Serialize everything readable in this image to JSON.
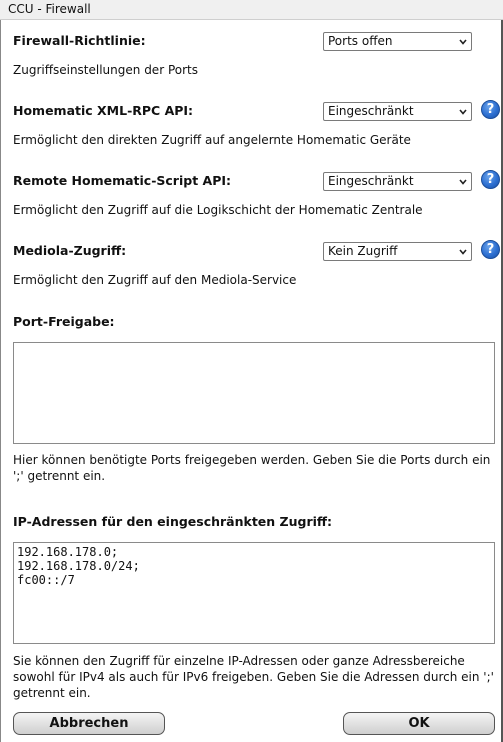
{
  "window": {
    "title": "CCU - Firewall"
  },
  "firewall_policy": {
    "label": "Firewall-Richtlinie:",
    "value": "Ports offen",
    "description": "Zugriffseinstellungen der Ports"
  },
  "xmlrpc_api": {
    "label": "Homematic XML-RPC API:",
    "value": "Eingeschränkt",
    "description": "Ermöglicht den direkten Zugriff auf angelernte Homematic Geräte"
  },
  "script_api": {
    "label": "Remote Homematic-Script API:",
    "value": "Eingeschränkt",
    "description": "Ermöglicht den Zugriff auf die Logikschicht der Homematic Zentrale"
  },
  "mediola": {
    "label": "Mediola-Zugriff:",
    "value": "Kein Zugriff",
    "description": "Ermöglicht den Zugriff auf den Mediola-Service"
  },
  "port_release": {
    "label": "Port-Freigabe:",
    "value": "",
    "description": "Hier können benötigte Ports freigegeben werden. Geben Sie die Ports durch ein ';' getrennt ein."
  },
  "ip_restricted": {
    "label": "IP-Adressen für den eingeschränkten Zugriff:",
    "value": "192.168.178.0;\n192.168.178.0/24;\nfc00::/7",
    "description": "Sie können den Zugriff für einzelne IP-Adressen oder ganze Adressbereiche sowohl für IPv4 als auch für IPv6 freigeben. Geben Sie die Adressen durch ein ';' getrennt ein."
  },
  "help_glyph": "?",
  "buttons": {
    "cancel": "Abbrechen",
    "ok": "OK"
  },
  "icons": {
    "help": "help-icon",
    "dropdown": "chevron-down-icon"
  },
  "colors": {
    "help_blue": "#2d6fd1",
    "button_top": "#f4f4f4",
    "button_bottom": "#cfcfcf"
  }
}
